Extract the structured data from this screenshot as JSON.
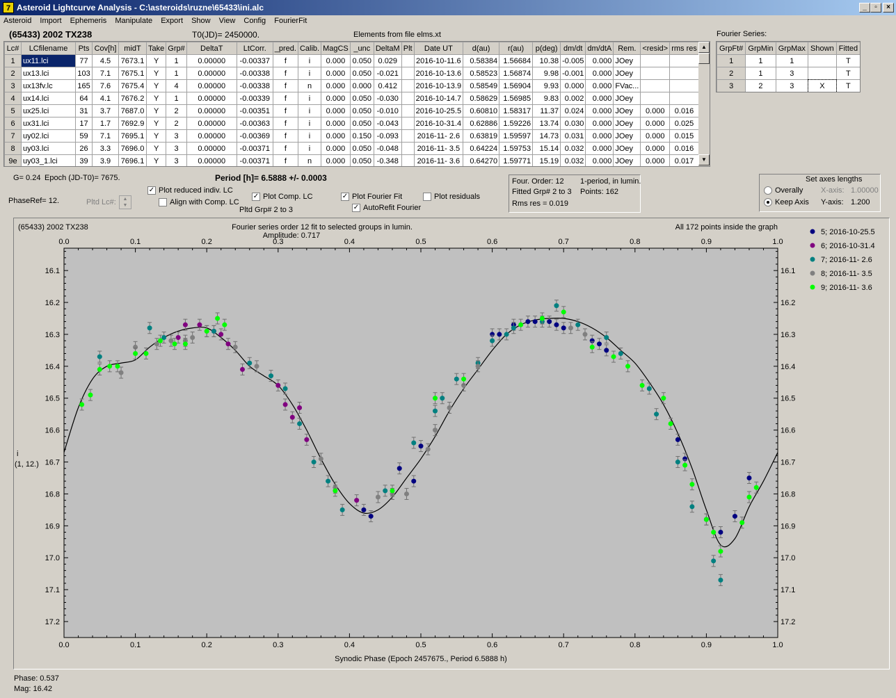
{
  "window": {
    "title": "Asteroid Lightcurve Analysis - C:\\asteroids\\ruzne\\65433\\ini.alc",
    "min_glyph": "_",
    "max_glyph": "▫",
    "close_glyph": "×"
  },
  "menu": [
    "Asteroid",
    "Import",
    "Ephemeris",
    "Manipulate",
    "Export",
    "Show",
    "View",
    "Config",
    "FourierFit"
  ],
  "header": {
    "asteroid": "(65433) 2002 TX238",
    "t0": "T0(JD)= 2450000.",
    "elements": "Elements from file elms.xt",
    "fourier_title": "Fourier Series:"
  },
  "lc_table": {
    "columns": [
      "Lc#",
      "LCfilename",
      "Pts",
      "Cov[h]",
      "midT",
      "Take",
      "Grp#",
      "DeltaT",
      "LtCorr.",
      "_pred.",
      "Calib.",
      "MagCS",
      "_unc",
      "DeltaM",
      "Plt",
      "Date UT",
      "d(au)",
      "r(au)",
      "p(deg)",
      "dm/dt",
      "dm/dtA",
      "Rem.",
      "<resid>",
      "rms res"
    ],
    "rows": [
      [
        "1",
        "ux11.lci",
        "77",
        "4.5",
        "7673.1",
        "Y",
        "1",
        "0.00000",
        "-0.00337",
        "f",
        "i",
        "0.000",
        "0.050",
        "0.029",
        "",
        "2016-10-11.6",
        "0.58384",
        "1.56684",
        "10.38",
        "-0.005",
        "0.000",
        "JOey",
        "",
        ""
      ],
      [
        "2",
        "ux13.lci",
        "103",
        "7.1",
        "7675.1",
        "Y",
        "1",
        "0.00000",
        "-0.00338",
        "f",
        "i",
        "0.000",
        "0.050",
        "-0.021",
        "",
        "2016-10-13.6",
        "0.58523",
        "1.56874",
        "9.98",
        "-0.001",
        "0.000",
        "JOey",
        "",
        ""
      ],
      [
        "3",
        "ux13fv.lc",
        "165",
        "7.6",
        "7675.4",
        "Y",
        "4",
        "0.00000",
        "-0.00338",
        "f",
        "n",
        "0.000",
        "0.000",
        "0.412",
        "",
        "2016-10-13.9",
        "0.58549",
        "1.56904",
        "9.93",
        "0.000",
        "0.000",
        "FVac...",
        "",
        ""
      ],
      [
        "4",
        "ux14.lci",
        "64",
        "4.1",
        "7676.2",
        "Y",
        "1",
        "0.00000",
        "-0.00339",
        "f",
        "i",
        "0.000",
        "0.050",
        "-0.030",
        "",
        "2016-10-14.7",
        "0.58629",
        "1.56985",
        "9.83",
        "0.002",
        "0.000",
        "JOey",
        "",
        ""
      ],
      [
        "5",
        "ux25.lci",
        "31",
        "3.7",
        "7687.0",
        "Y",
        "2",
        "0.00000",
        "-0.00351",
        "f",
        "i",
        "0.000",
        "0.050",
        "-0.010",
        "",
        "2016-10-25.5",
        "0.60810",
        "1.58317",
        "11.37",
        "0.024",
        "0.000",
        "JOey",
        "0.000",
        "0.016"
      ],
      [
        "6",
        "ux31.lci",
        "17",
        "1.7",
        "7692.9",
        "Y",
        "2",
        "0.00000",
        "-0.00363",
        "f",
        "i",
        "0.000",
        "0.050",
        "-0.043",
        "",
        "2016-10-31.4",
        "0.62886",
        "1.59226",
        "13.74",
        "0.030",
        "0.000",
        "JOey",
        "0.000",
        "0.025"
      ],
      [
        "7",
        "uy02.lci",
        "59",
        "7.1",
        "7695.1",
        "Y",
        "3",
        "0.00000",
        "-0.00369",
        "f",
        "i",
        "0.000",
        "0.150",
        "-0.093",
        "",
        "2016-11- 2.6",
        "0.63819",
        "1.59597",
        "14.73",
        "0.031",
        "0.000",
        "JOey",
        "0.000",
        "0.015"
      ],
      [
        "8",
        "uy03.lci",
        "26",
        "3.3",
        "7696.0",
        "Y",
        "3",
        "0.00000",
        "-0.00371",
        "f",
        "i",
        "0.000",
        "0.050",
        "-0.048",
        "",
        "2016-11- 3.5",
        "0.64224",
        "1.59753",
        "15.14",
        "0.032",
        "0.000",
        "JOey",
        "0.000",
        "0.016"
      ],
      [
        "9e",
        "uy03_1.lci",
        "39",
        "3.9",
        "7696.1",
        "Y",
        "3",
        "0.00000",
        "-0.00371",
        "f",
        "n",
        "0.000",
        "0.050",
        "-0.348",
        "",
        "2016-11- 3.6",
        "0.64270",
        "1.59771",
        "15.19",
        "0.032",
        "0.000",
        "JOey",
        "0.000",
        "0.017"
      ]
    ]
  },
  "fourier_table": {
    "columns": [
      "GrpFt#",
      "GrpMin",
      "GrpMax",
      "Shown",
      "Fitted"
    ],
    "rows": [
      [
        "1",
        "1",
        "1",
        "",
        "T"
      ],
      [
        "2",
        "1",
        "3",
        "",
        "T"
      ],
      [
        "3",
        "2",
        "3",
        "X",
        "T"
      ]
    ]
  },
  "controls": {
    "g": "G= 0.24",
    "epoch": "Epoch (JD-T0)= 7675.",
    "period": "Period [h]= 6.5888 +/- 0.0003",
    "phaseref": "PhaseRef= 12.",
    "pltd_lc": "Pltd Lc#:",
    "plot_reduced": "Plot reduced indiv. LC",
    "align": "Align with Comp. LC",
    "plot_comp": "Plot Comp. LC",
    "pltd_grp": "Pltd Grp#  2  to   3",
    "plot_fourier": "Plot Fourier Fit",
    "autorefit": "AutoRefit Fourier",
    "plot_residuals": "Plot residuals",
    "check_on": "✓"
  },
  "info_box": {
    "line1a": "Four. Order: 12",
    "line1b": "1-period, in lumin.",
    "line2a": "Fitted Grp# 2 to 3",
    "line2b": "Points: 162",
    "line3": "Rms res    = 0.019"
  },
  "axes_box": {
    "title": "Set axes lengths",
    "overally": "Overally",
    "keep_axis": "Keep Axis",
    "xaxis_label": "X-axis:",
    "xaxis_value": "1.00000",
    "yaxis_label": "Y-axis:",
    "yaxis_value": "1.200"
  },
  "plot": {
    "top_left": "(65433) 2002 TX238",
    "top_center1": "Fourier series order 12 fit to selected groups in lumin.",
    "top_center2": "Amplitude: 0.717",
    "top_right": "All 172 points inside the graph",
    "ylabel1": "i",
    "ylabel2": "(1, 12.)",
    "xlabel": "Synodic Phase (Epoch 2457675., Period 6.5888 h)",
    "legend": [
      {
        "label": "5; 2016-10-25.5",
        "color": "#000080"
      },
      {
        "label": "6; 2016-10-31.4",
        "color": "#800080"
      },
      {
        "label": "7; 2016-11- 2.6",
        "color": "#008080"
      },
      {
        "label": "8; 2016-11- 3.5",
        "color": "#808080"
      },
      {
        "label": "9; 2016-11- 3.6",
        "color": "#00ff00"
      }
    ]
  },
  "status": {
    "phase": "Phase:  0.537",
    "mag": "Mag:   16.42"
  },
  "chart_data": {
    "type": "scatter",
    "title": "Fourier series order 12 fit to selected groups in lumin.",
    "xlabel": "Synodic Phase (Epoch 2457675., Period 6.5888 h)",
    "ylabel": "i",
    "xlim": [
      0,
      1
    ],
    "ylim": [
      17.25,
      16.03
    ],
    "y_inverted": true,
    "grid": false,
    "legend_position": "top-right",
    "x_ticks": [
      "0.0",
      "0.1",
      "0.2",
      "0.3",
      "0.4",
      "0.5",
      "0.6",
      "0.7",
      "0.8",
      "0.9",
      "1.0"
    ],
    "y_ticks": [
      "16.1",
      "16.2",
      "16.3",
      "16.4",
      "16.5",
      "16.6",
      "16.7",
      "16.8",
      "16.9",
      "17.0",
      "17.1",
      "17.2"
    ],
    "fit_curve": {
      "name": "Fourier fit",
      "x": [
        0,
        0.02,
        0.04,
        0.06,
        0.08,
        0.1,
        0.12,
        0.14,
        0.16,
        0.18,
        0.2,
        0.22,
        0.24,
        0.26,
        0.28,
        0.3,
        0.32,
        0.34,
        0.36,
        0.38,
        0.4,
        0.42,
        0.44,
        0.46,
        0.48,
        0.5,
        0.52,
        0.54,
        0.56,
        0.58,
        0.6,
        0.62,
        0.64,
        0.66,
        0.68,
        0.7,
        0.72,
        0.74,
        0.76,
        0.78,
        0.8,
        0.82,
        0.84,
        0.86,
        0.88,
        0.9,
        0.92,
        0.94,
        0.96,
        0.98,
        1.0
      ],
      "y": [
        16.67,
        16.53,
        16.44,
        16.4,
        16.39,
        16.38,
        16.34,
        16.31,
        16.29,
        16.28,
        16.28,
        16.31,
        16.35,
        16.4,
        16.43,
        16.46,
        16.52,
        16.6,
        16.69,
        16.77,
        16.83,
        16.86,
        16.85,
        16.81,
        16.75,
        16.69,
        16.62,
        16.54,
        16.47,
        16.41,
        16.35,
        16.3,
        16.27,
        16.255,
        16.25,
        16.25,
        16.26,
        16.28,
        16.31,
        16.35,
        16.39,
        16.45,
        16.52,
        16.61,
        16.72,
        16.85,
        16.96,
        16.94,
        16.84,
        16.76,
        16.67
      ]
    },
    "series": [
      {
        "name": "5; 2016-10-25.5",
        "color": "#000080",
        "x": [
          0.42,
          0.43,
          0.47,
          0.49,
          0.5,
          0.6,
          0.61,
          0.63,
          0.65,
          0.66,
          0.68,
          0.69,
          0.7,
          0.74,
          0.75,
          0.76,
          0.86,
          0.87,
          0.9,
          0.92,
          0.94,
          0.96
        ],
        "y": [
          16.85,
          16.87,
          16.72,
          16.76,
          16.65,
          16.3,
          16.3,
          16.27,
          16.26,
          16.26,
          16.26,
          16.27,
          16.28,
          16.32,
          16.33,
          16.35,
          16.63,
          16.69,
          16.88,
          16.92,
          16.87,
          16.75
        ]
      },
      {
        "name": "6; 2016-10-31.4",
        "color": "#800080",
        "x": [
          0.16,
          0.17,
          0.19,
          0.21,
          0.22,
          0.23,
          0.25,
          0.3,
          0.31,
          0.32,
          0.33,
          0.34,
          0.41
        ],
        "y": [
          16.31,
          16.27,
          16.27,
          16.29,
          16.3,
          16.33,
          16.41,
          16.46,
          16.52,
          16.56,
          16.53,
          16.63,
          16.82
        ]
      },
      {
        "name": "7; 2016-11- 2.6",
        "color": "#008080",
        "x": [
          0.05,
          0.12,
          0.14,
          0.21,
          0.26,
          0.29,
          0.31,
          0.33,
          0.35,
          0.37,
          0.39,
          0.45,
          0.49,
          0.52,
          0.53,
          0.55,
          0.58,
          0.6,
          0.62,
          0.63,
          0.67,
          0.69,
          0.72,
          0.76,
          0.78,
          0.82,
          0.83,
          0.86,
          0.88,
          0.91,
          0.92
        ],
        "y": [
          16.37,
          16.28,
          16.31,
          16.29,
          16.39,
          16.43,
          16.47,
          16.58,
          16.7,
          16.76,
          16.85,
          16.79,
          16.64,
          16.54,
          16.5,
          16.44,
          16.39,
          16.32,
          16.3,
          16.28,
          16.26,
          16.21,
          16.27,
          16.31,
          16.36,
          16.47,
          16.55,
          16.7,
          16.84,
          17.01,
          17.07
        ]
      },
      {
        "name": "8; 2016-11- 3.5",
        "color": "#808080",
        "x": [
          0.08,
          0.1,
          0.13,
          0.15,
          0.17,
          0.18,
          0.2,
          0.24,
          0.27,
          0.36,
          0.38,
          0.44,
          0.46,
          0.48,
          0.51,
          0.52,
          0.54,
          0.56,
          0.58,
          0.71,
          0.73
        ],
        "y": [
          16.42,
          16.34,
          16.33,
          16.32,
          16.32,
          16.31,
          16.29,
          16.34,
          16.4,
          16.69,
          16.78,
          16.81,
          16.8,
          16.8,
          16.66,
          16.6,
          16.53,
          16.46,
          16.4,
          16.28,
          16.3
        ],
        "note": "x"
      },
      {
        "name": "9; 2016-11- 3.6",
        "color": "#00ff00",
        "x": [
          0.025,
          0.037,
          0.05,
          0.064,
          0.075,
          0.1,
          0.115,
          0.135,
          0.155,
          0.17,
          0.2,
          0.215,
          0.225,
          0.38,
          0.46,
          0.52,
          0.56,
          0.64,
          0.67,
          0.7,
          0.74,
          0.77,
          0.79,
          0.81,
          0.84,
          0.85,
          0.87,
          0.88,
          0.9,
          0.91,
          0.92,
          0.95,
          0.96,
          0.97
        ],
        "y": [
          16.52,
          16.49,
          16.41,
          16.4,
          16.4,
          16.36,
          16.36,
          16.32,
          16.33,
          16.33,
          16.29,
          16.25,
          16.27,
          16.79,
          16.79,
          16.5,
          16.44,
          16.27,
          16.25,
          16.23,
          16.34,
          16.37,
          16.4,
          16.46,
          16.5,
          16.58,
          16.71,
          16.77,
          16.88,
          16.92,
          16.98,
          16.89,
          16.81,
          16.78
        ]
      }
    ]
  }
}
